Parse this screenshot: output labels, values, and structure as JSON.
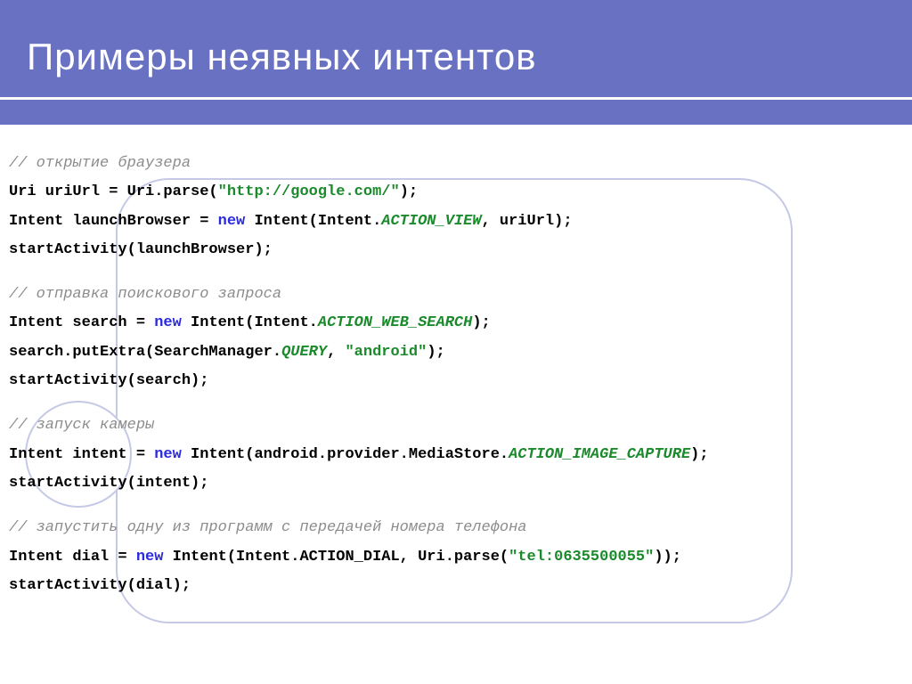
{
  "title": "Примеры неявных интентов",
  "code": {
    "c1": "// открытие браузера",
    "l1a": "Uri uriUrl = Uri.parse(",
    "l1b": "\"http://google.com/\"",
    "l1c": ");",
    "l2a": "Intent launchBrowser = ",
    "l2b": "new",
    "l2c": " Intent(Intent.",
    "l2d": "ACTION_VIEW",
    "l2e": ", uriUrl);",
    "l3": "startActivity(launchBrowser);",
    "c2": "// отправка поискового запроса",
    "l4a": "Intent search = ",
    "l4b": "new",
    "l4c": " Intent(Intent.",
    "l4d": "ACTION_WEB_SEARCH",
    "l4e": ");",
    "l5a": "search.putExtra(SearchManager.",
    "l5b": "QUERY",
    "l5c": ", ",
    "l5d": "\"android\"",
    "l5e": ");",
    "l6": "startActivity(search);",
    "c3": "// запуск камеры",
    "l7a": "Intent intent = ",
    "l7b": "new",
    "l7c": " Intent(android.provider.MediaStore.",
    "l7d": "ACTION_IMAGE_CAPTURE",
    "l7e": ");",
    "l8": "startActivity(intent);",
    "c4": "// запустить одну из программ с передачей номера телефона",
    "l9a": "Intent dial = ",
    "l9b": "new",
    "l9c": " Intent(Intent.ACTION_DIAL, Uri.parse(",
    "l9d": "\"tel:0635500055\"",
    "l9e": "));",
    "l10": "startActivity(dial);"
  }
}
